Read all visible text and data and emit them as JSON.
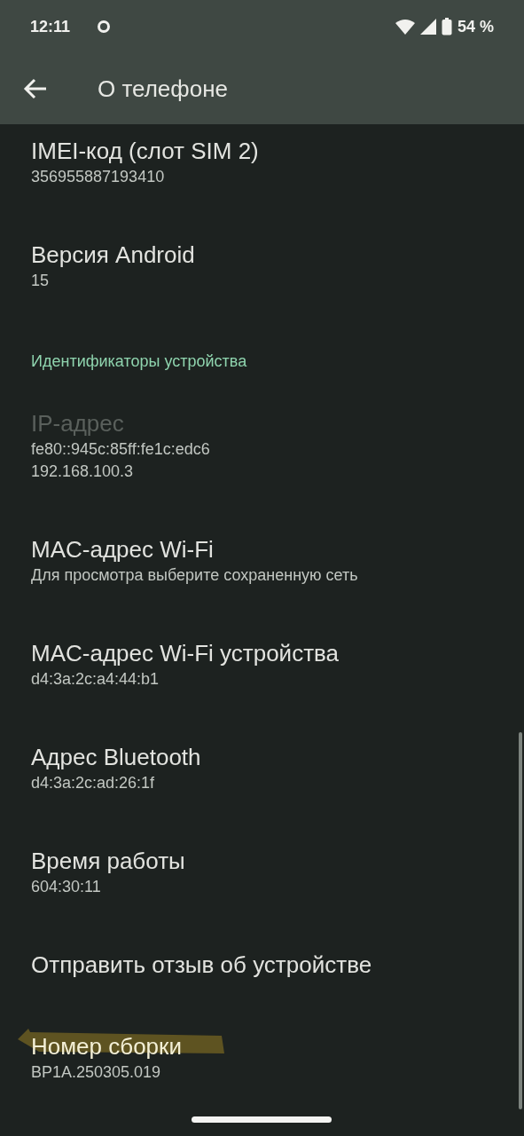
{
  "status_bar": {
    "time": "12:11",
    "battery": "54 %"
  },
  "app_bar": {
    "title": "О телефоне"
  },
  "items": [
    {
      "kind": "item",
      "title": "IMEI-код (слот SIM 2)",
      "lines": [
        "356955887193410"
      ],
      "disabled": false,
      "marked": false
    },
    {
      "kind": "item",
      "title": "Версия Android",
      "lines": [
        "15"
      ],
      "disabled": false,
      "marked": false
    },
    {
      "kind": "section",
      "title": "Идентификаторы устройства"
    },
    {
      "kind": "item",
      "title": "IP-адрес",
      "lines": [
        "fe80::945c:85ff:fe1c:edc6",
        "192.168.100.3"
      ],
      "disabled": true,
      "marked": false
    },
    {
      "kind": "item",
      "title": "MAC-адрес Wi-Fi",
      "lines": [
        "Для просмотра выберите сохраненную сеть"
      ],
      "disabled": false,
      "marked": false
    },
    {
      "kind": "item",
      "title": "MAC-адрес Wi-Fi устройства",
      "lines": [
        "d4:3a:2c:a4:44:b1"
      ],
      "disabled": false,
      "marked": false
    },
    {
      "kind": "item",
      "title": "Адрес Bluetooth",
      "lines": [
        "d4:3a:2c:ad:26:1f"
      ],
      "disabled": false,
      "marked": false
    },
    {
      "kind": "item",
      "title": "Время работы",
      "lines": [
        "604:30:11"
      ],
      "disabled": false,
      "marked": false
    },
    {
      "kind": "item",
      "title": "Отправить отзыв об устройстве",
      "disabled": false,
      "marked": false
    },
    {
      "kind": "item",
      "title": "Номер сборки",
      "lines": [
        "BP1A.250305.019"
      ],
      "disabled": false,
      "marked": true
    }
  ]
}
